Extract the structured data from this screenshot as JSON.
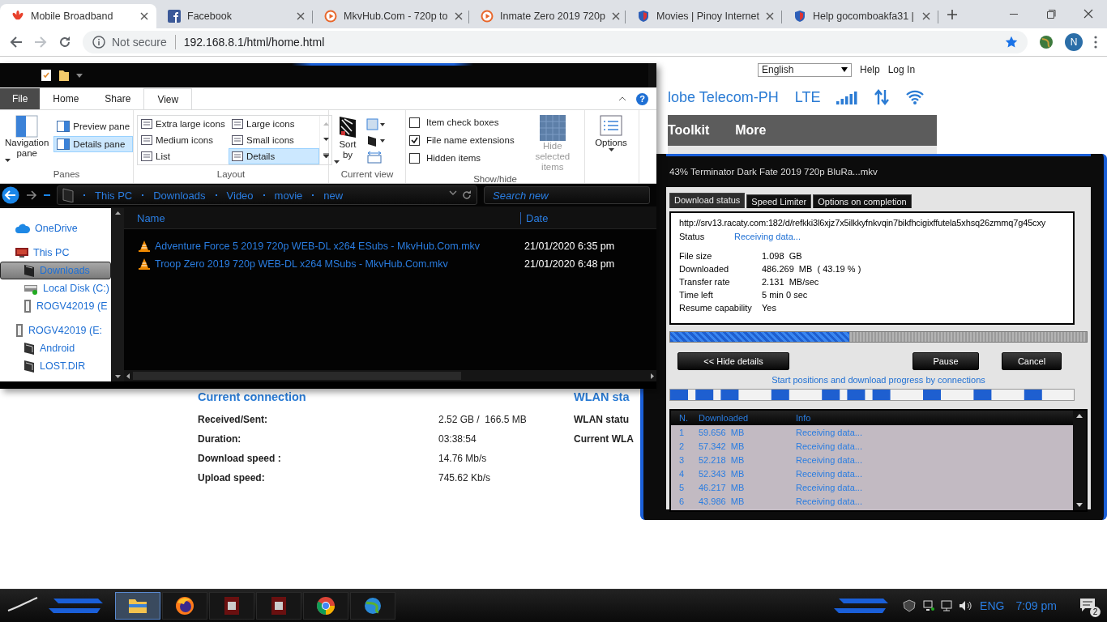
{
  "browser": {
    "tabs": [
      {
        "kind": "huawei",
        "label": "Mobile Broadband",
        "selected": true
      },
      {
        "kind": "facebook",
        "label": "Facebook",
        "selected": false
      },
      {
        "kind": "play",
        "label": "MkvHub.Com - 720p to",
        "selected": false
      },
      {
        "kind": "play",
        "label": "Inmate Zero 2019 720p",
        "selected": false
      },
      {
        "kind": "shield",
        "label": "Movies | Pinoy Internet",
        "selected": false
      },
      {
        "kind": "shield",
        "label": "Help gocomboakfa31 |",
        "selected": false
      }
    ],
    "security": "Not secure",
    "url": "192.168.8.1/html/home.html",
    "profile": "N"
  },
  "webpage": {
    "language": "English",
    "links": [
      "Help",
      "Log In"
    ],
    "operator": "lobe Telecom-PH",
    "network": "LTE",
    "menu": [
      "Toolkit",
      "More"
    ],
    "current_connection": {
      "title": "Current connection",
      "rows": [
        {
          "label": "Received/Sent:",
          "value": "2.52 GB /  166.5 MB"
        },
        {
          "label": "Duration:",
          "value": "03:38:54"
        },
        {
          "label": "Download speed :",
          "value": "14.76 Mb/s"
        },
        {
          "label": "Upload speed:",
          "value": "745.62 Kb/s"
        }
      ]
    },
    "wlan": {
      "title": "WLAN sta",
      "labels": [
        "WLAN statu",
        "Current WLA"
      ]
    }
  },
  "explorer": {
    "tabs": [
      {
        "kind": "file",
        "label": "File",
        "selected": false
      },
      {
        "kind": "tab",
        "label": "Home",
        "selected": false
      },
      {
        "kind": "tab",
        "label": "Share",
        "selected": false
      },
      {
        "kind": "tab",
        "label": "View",
        "selected": true
      }
    ],
    "help": "?",
    "panes": {
      "label": "Panes",
      "navigation": "Navigation pane",
      "items": [
        {
          "label": "Preview pane",
          "selected": false
        },
        {
          "label": "Details pane",
          "selected": true
        }
      ]
    },
    "layout": {
      "label": "Layout",
      "options": [
        {
          "label": "Extra large icons",
          "selected": false
        },
        {
          "label": "Large icons",
          "selected": false
        },
        {
          "label": "Medium icons",
          "selected": false
        },
        {
          "label": "Small icons",
          "selected": false
        },
        {
          "label": "List",
          "selected": false
        },
        {
          "label": "Details",
          "selected": true
        }
      ]
    },
    "current_view": {
      "label": "Current view",
      "sort": "Sort by"
    },
    "show_hide": {
      "label": "Show/hide",
      "options": [
        {
          "label": "Item check boxes",
          "checked": false
        },
        {
          "label": "File name extensions",
          "checked": true
        },
        {
          "label": "Hidden items",
          "checked": false
        }
      ],
      "hide_selected": {
        "label": "Hide selected items",
        "disabled": true
      }
    },
    "options": "Options",
    "breadcrumb": [
      "This PC",
      "Downloads",
      "Video",
      "movie",
      "new"
    ],
    "search": {
      "placeholder": "Search new"
    },
    "tree": [
      {
        "kind": "cloud",
        "label": "OneDrive",
        "selected": false
      },
      {
        "kind": "pc",
        "label": "This PC",
        "selected": false,
        "children": [
          {
            "kind": "download",
            "label": "Downloads",
            "selected": true
          },
          {
            "kind": "disk",
            "label": "Local Disk (C:)",
            "selected": false
          },
          {
            "kind": "usb",
            "label": "ROGV42019 (E",
            "selected": false
          }
        ]
      },
      {
        "kind": "usb",
        "label": "ROGV42019 (E:",
        "selected": false,
        "children": [
          {
            "kind": "folder",
            "label": "Android",
            "selected": false
          },
          {
            "kind": "folder",
            "label": "LOST.DIR",
            "selected": false
          }
        ]
      }
    ],
    "columns": [
      "Name",
      "Date"
    ],
    "files": [
      {
        "name": "Adventure Force 5 2019 720p WEB-DL x264 ESubs - MkvHub.Com.mkv",
        "date": "21/01/2020 6:35 pm"
      },
      {
        "name": "Troop Zero 2019 720p WEB-DL x264 MSubs - MkvHub.Com.mkv",
        "date": "21/01/2020 6:48 pm"
      }
    ]
  },
  "download": {
    "title": "43% Terminator Dark Fate 2019 720p BluRa...mkv",
    "tabs": [
      {
        "label": "Download status",
        "selected": true
      },
      {
        "label": "Speed Limiter",
        "selected": false
      },
      {
        "label": "Options on completion",
        "selected": false
      }
    ],
    "url": "http://srv13.racaty.com:182/d/refkki3l6xjz7x5ilkkyfnkvqin7bikfhcigixffutela5xhsq26zmmq7g45cxy",
    "status": {
      "label": "Status",
      "value": "Receiving data..."
    },
    "fields": [
      {
        "label": "File size",
        "value": "1.098  GB"
      },
      {
        "label": "Downloaded",
        "value": "486.269  MB  ( 43.19 % )"
      },
      {
        "label": "Transfer rate",
        "value": "2.131  MB/sec"
      },
      {
        "label": "Time left",
        "value": "5 min 0 sec"
      },
      {
        "label": "Resume capability",
        "value": "Yes"
      }
    ],
    "progress": {
      "level": 0.43
    },
    "buttons": [
      "<< Hide details",
      "Pause",
      "Cancel"
    ],
    "caption": "Start positions and download progress by connections",
    "columns": [
      "N.",
      "Downloaded",
      "Info"
    ],
    "connections": [
      {
        "n": "1",
        "downloaded": "59.656  MB",
        "info": "Receiving data..."
      },
      {
        "n": "2",
        "downloaded": "57.342  MB",
        "info": "Receiving data..."
      },
      {
        "n": "3",
        "downloaded": "52.218  MB",
        "info": "Receiving data..."
      },
      {
        "n": "4",
        "downloaded": "52.343  MB",
        "info": "Receiving data..."
      },
      {
        "n": "5",
        "downloaded": "46.217  MB",
        "info": "Receiving data..."
      },
      {
        "n": "6",
        "downloaded": "43.986  MB",
        "info": "Receiving data..."
      }
    ]
  },
  "taskbar": {
    "apps": [
      {
        "kind": "folder",
        "selected": true
      },
      {
        "kind": "firefox",
        "selected": false
      },
      {
        "kind": "app",
        "selected": false
      },
      {
        "kind": "app",
        "selected": false
      },
      {
        "kind": "chrome",
        "selected": false
      },
      {
        "kind": "globe",
        "selected": false
      }
    ],
    "language": "ENG",
    "time": "7:09 pm",
    "notifications": "2"
  }
}
